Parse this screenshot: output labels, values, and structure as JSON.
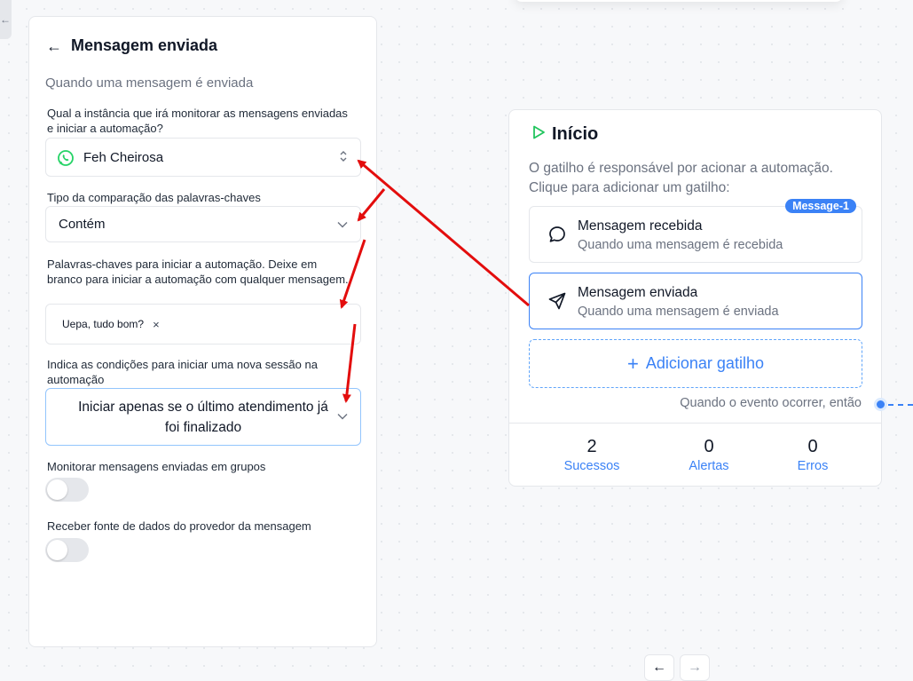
{
  "panel": {
    "title": "Mensagem enviada",
    "subtitle": "Quando uma mensagem é enviada",
    "instance_label": "Qual a instância que irá monitorar as mensagens enviadas e iniciar a automação?",
    "instance_value": "Feh Cheirosa",
    "comparison_label": "Tipo da comparação das palavras-chaves",
    "comparison_value": "Contém",
    "keywords_label": "Palavras-chaves para iniciar a automação. Deixe em branco para iniciar a automação com qualquer mensagem.",
    "keywords": [
      "Uepa, tudo bom?"
    ],
    "tag_remove": "×",
    "session_label": "Indica as condições para iniciar uma nova sessão na automação",
    "session_value": "Iniciar apenas se o último atendimento já foi finalizado",
    "groups_label": "Monitorar mensagens enviadas em grupos",
    "groups_enabled": false,
    "provider_label": "Receber fonte de dados do provedor da mensagem",
    "provider_enabled": false
  },
  "card": {
    "title": "Início",
    "description": "O gatilho é responsável por acionar a automação. Clique para adicionar um gatilho:",
    "triggers": [
      {
        "name": "Mensagem recebida",
        "description": "Quando uma mensagem é recebida",
        "badge": "Message-1",
        "icon": "chat-bubble-icon"
      },
      {
        "name": "Mensagem enviada",
        "description": "Quando uma mensagem é enviada",
        "icon": "send-icon",
        "selected": true
      }
    ],
    "add_trigger": "Adicionar gatilho",
    "event_text": "Quando o evento ocorrer, então",
    "stats": [
      {
        "value": "2",
        "label": "Sucessos"
      },
      {
        "value": "0",
        "label": "Alertas"
      },
      {
        "value": "0",
        "label": "Erros"
      }
    ]
  },
  "nav": {
    "prev": "←",
    "next": "→"
  },
  "colors": {
    "accent": "#3b82f6",
    "whatsapp": "#25d366",
    "play": "#22c55e",
    "annotation": "#e30d0d"
  }
}
